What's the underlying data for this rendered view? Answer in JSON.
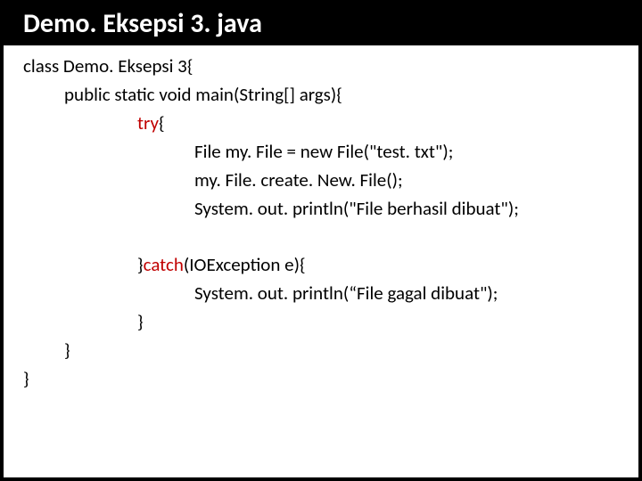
{
  "title": "Demo. Eksepsi 3. java",
  "code": {
    "l1": "class Demo. Eksepsi 3{",
    "l2": "public static void main(String[] args){",
    "l3a": "try",
    "l3b": "{",
    "l4": "File my. File = new File(\"test. txt\");",
    "l5": "my. File. create. New. File();",
    "l6": "System. out. println(\"File berhasil dibuat\");",
    "l7a": "}",
    "l7b": "catch",
    "l7c": "(IOException e){",
    "l8": "System. out. println(“File gagal dibuat\");",
    "l9": "}",
    "l10": "}",
    "l11": "}"
  }
}
